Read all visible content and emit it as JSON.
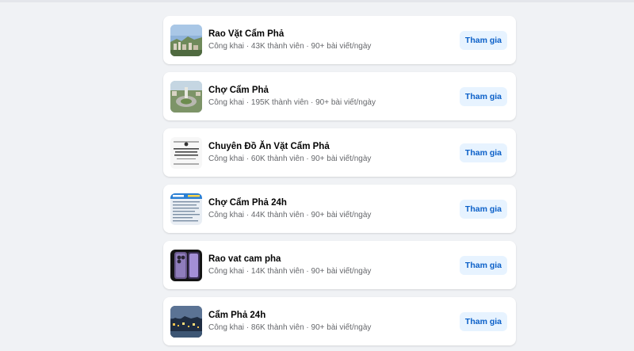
{
  "groups": [
    {
      "name": "Rao Vặt Cẩm Phả",
      "meta": "Công khai · 43K thành viên · 90+ bài viết/ngày",
      "join_label": "Tham gia",
      "thumb_icon": "city-skyline-thumbnail"
    },
    {
      "name": "Chợ Cẩm Phả",
      "meta": "Công khai · 195K thành viên · 90+ bài viết/ngày",
      "join_label": "Tham gia",
      "thumb_icon": "roundabout-aerial-thumbnail"
    },
    {
      "name": "Chuyên Đồ Ăn Vặt Cẩm Phả",
      "meta": "Công khai · 60K thành viên · 90+ bài viết/ngày",
      "join_label": "Tham gia",
      "thumb_icon": "logo-text-thumbnail"
    },
    {
      "name": "Chợ Cẩm Phả 24h",
      "meta": "Công khai · 44K thành viên · 90+ bài viết/ngày",
      "join_label": "Tham gia",
      "thumb_icon": "document-thumbnail"
    },
    {
      "name": "Rao vat cam pha",
      "meta": "Công khai · 14K thành viên · 90+ bài viết/ngày",
      "join_label": "Tham gia",
      "thumb_icon": "smartphone-thumbnail"
    },
    {
      "name": "Cẩm Phả 24h",
      "meta": "Công khai · 86K thành viên · 90+ bài viết/ngày",
      "join_label": "Tham gia",
      "thumb_icon": "city-night-thumbnail"
    }
  ],
  "colors": {
    "background": "#f0f2f5",
    "card": "#ffffff",
    "join_bg": "#e7f3ff",
    "join_text": "#0a5fc8",
    "meta_text": "#65676b"
  }
}
